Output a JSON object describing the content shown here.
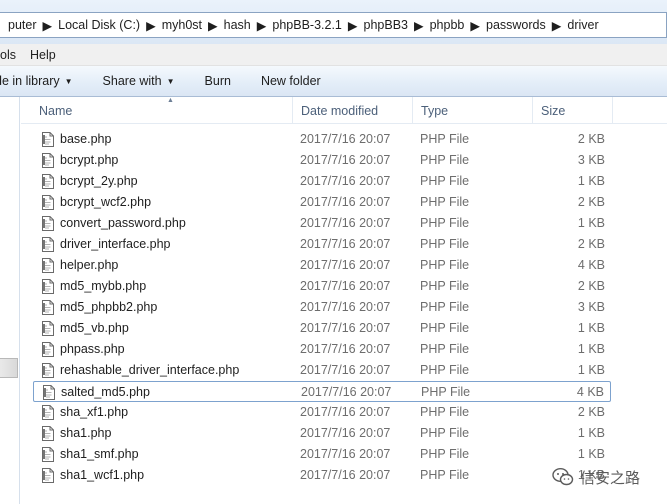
{
  "address": {
    "crumbs": [
      "puter",
      "Local Disk (C:)",
      "myh0st",
      "hash",
      "phpBB-3.2.1",
      "phpBB3",
      "phpbb",
      "passwords",
      "driver"
    ]
  },
  "menu": {
    "items": [
      "ols",
      "Help"
    ]
  },
  "toolbar": {
    "include_library": "de in library",
    "share_with": "Share with",
    "burn": "Burn",
    "new_folder": "New folder"
  },
  "columns": {
    "name": "Name",
    "date": "Date modified",
    "type": "Type",
    "size": "Size"
  },
  "files": [
    {
      "name": "base.php",
      "date": "2017/7/16 20:07",
      "type": "PHP File",
      "size": "2 KB"
    },
    {
      "name": "bcrypt.php",
      "date": "2017/7/16 20:07",
      "type": "PHP File",
      "size": "3 KB"
    },
    {
      "name": "bcrypt_2y.php",
      "date": "2017/7/16 20:07",
      "type": "PHP File",
      "size": "1 KB"
    },
    {
      "name": "bcrypt_wcf2.php",
      "date": "2017/7/16 20:07",
      "type": "PHP File",
      "size": "2 KB"
    },
    {
      "name": "convert_password.php",
      "date": "2017/7/16 20:07",
      "type": "PHP File",
      "size": "1 KB"
    },
    {
      "name": "driver_interface.php",
      "date": "2017/7/16 20:07",
      "type": "PHP File",
      "size": "2 KB"
    },
    {
      "name": "helper.php",
      "date": "2017/7/16 20:07",
      "type": "PHP File",
      "size": "4 KB"
    },
    {
      "name": "md5_mybb.php",
      "date": "2017/7/16 20:07",
      "type": "PHP File",
      "size": "2 KB"
    },
    {
      "name": "md5_phpbb2.php",
      "date": "2017/7/16 20:07",
      "type": "PHP File",
      "size": "3 KB"
    },
    {
      "name": "md5_vb.php",
      "date": "2017/7/16 20:07",
      "type": "PHP File",
      "size": "1 KB"
    },
    {
      "name": "phpass.php",
      "date": "2017/7/16 20:07",
      "type": "PHP File",
      "size": "1 KB"
    },
    {
      "name": "rehashable_driver_interface.php",
      "date": "2017/7/16 20:07",
      "type": "PHP File",
      "size": "1 KB"
    },
    {
      "name": "salted_md5.php",
      "date": "2017/7/16 20:07",
      "type": "PHP File",
      "size": "4 KB",
      "selected": true
    },
    {
      "name": "sha_xf1.php",
      "date": "2017/7/16 20:07",
      "type": "PHP File",
      "size": "2 KB"
    },
    {
      "name": "sha1.php",
      "date": "2017/7/16 20:07",
      "type": "PHP File",
      "size": "1 KB"
    },
    {
      "name": "sha1_smf.php",
      "date": "2017/7/16 20:07",
      "type": "PHP File",
      "size": "1 KB"
    },
    {
      "name": "sha1_wcf1.php",
      "date": "2017/7/16 20:07",
      "type": "PHP File",
      "size": "1 KB"
    }
  ],
  "watermark": {
    "text": "信安之路"
  },
  "icons": {
    "file": "php-file-icon",
    "sort": "sort-up-icon",
    "watermark": "wechat-icon",
    "separator": "chevron-right-icon",
    "dropdown": "caret-down-icon"
  },
  "colors": {
    "selection_border": "#7da2ce",
    "toolbar_bg": "#e3edf8",
    "header_text": "#4c607a"
  }
}
